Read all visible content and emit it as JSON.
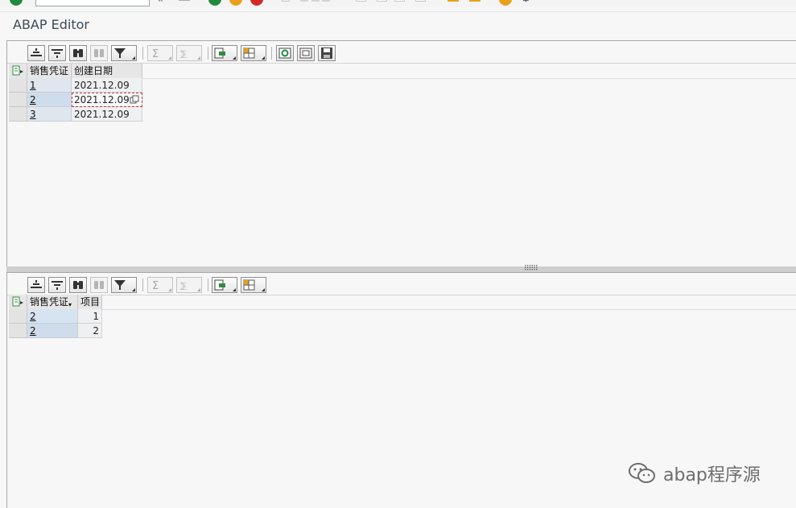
{
  "app": {
    "title": "ABAP Editor"
  },
  "top_grid": {
    "columns": [
      "销售凭证",
      "创建日期"
    ],
    "rows": [
      {
        "doc": "1",
        "date": "2021.12.09"
      },
      {
        "doc": "2",
        "date": "2021.12.09"
      },
      {
        "doc": "3",
        "date": "2021.12.09"
      }
    ]
  },
  "bottom_grid": {
    "columns": [
      "销售凭证",
      "项目"
    ],
    "rows": [
      {
        "doc": "2",
        "item": "1"
      },
      {
        "doc": "2",
        "item": "2"
      }
    ]
  },
  "splitter": {
    "grip": "⠿⠿⠿"
  },
  "watermark": {
    "text": "abap程序源"
  },
  "colors": {
    "accent_green": "#1f8a3c",
    "accent_orange": "#e8a21a",
    "accent_red": "#d12a2a",
    "selection_blue": "#cfdcec"
  }
}
